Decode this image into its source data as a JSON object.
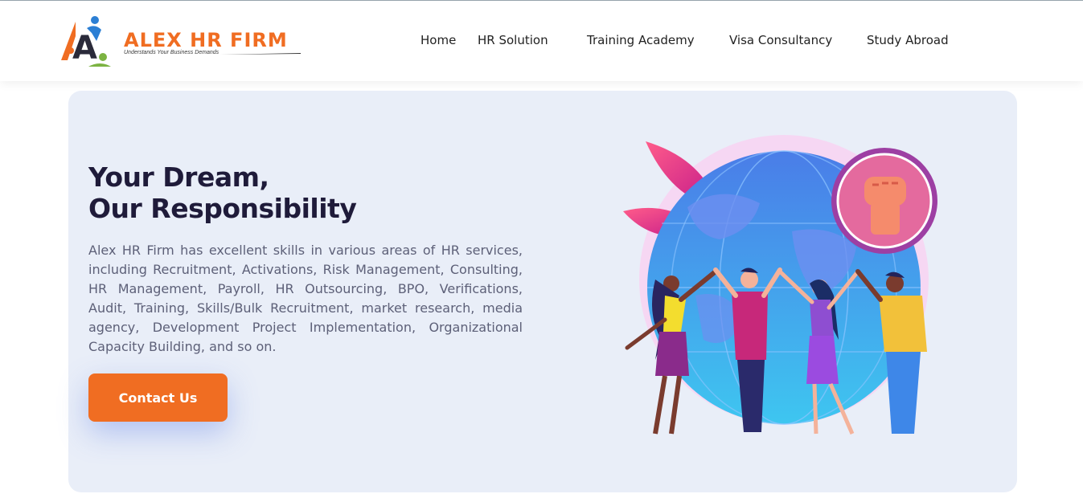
{
  "brand": {
    "name": "ALEX HR FIRM",
    "tagline": "Understands Your Business Demands",
    "logo_letter": "A",
    "colors": {
      "primary": "#f06d22",
      "blue": "#2c7fd4",
      "green": "#7cb342"
    }
  },
  "nav": {
    "items": [
      {
        "label": "Home"
      },
      {
        "label": "HR Solution"
      },
      {
        "label": "Training Academy"
      },
      {
        "label": "Visa Consultancy"
      },
      {
        "label": "Study Abroad"
      }
    ]
  },
  "hero": {
    "title_line1": "Your Dream,",
    "title_line2": "Our Responsibility",
    "description": "Alex HR Firm has excellent skills in various areas of HR services, including Recruitment, Activations, Risk Management, Consulting, HR Management, Payroll, HR Outsourcing, BPO, Verifications, Audit, Training, Skills/Bulk Recruitment, market research, media agency, Development Project Implementation, Organizational Capacity Building, and so on.",
    "cta_label": "Contact Us",
    "background": "#e9eef8",
    "illustration": "team-unity-globe-illustration"
  },
  "icons": [
    "raised-fist-icon",
    "globe-icon",
    "leaf-icon"
  ]
}
